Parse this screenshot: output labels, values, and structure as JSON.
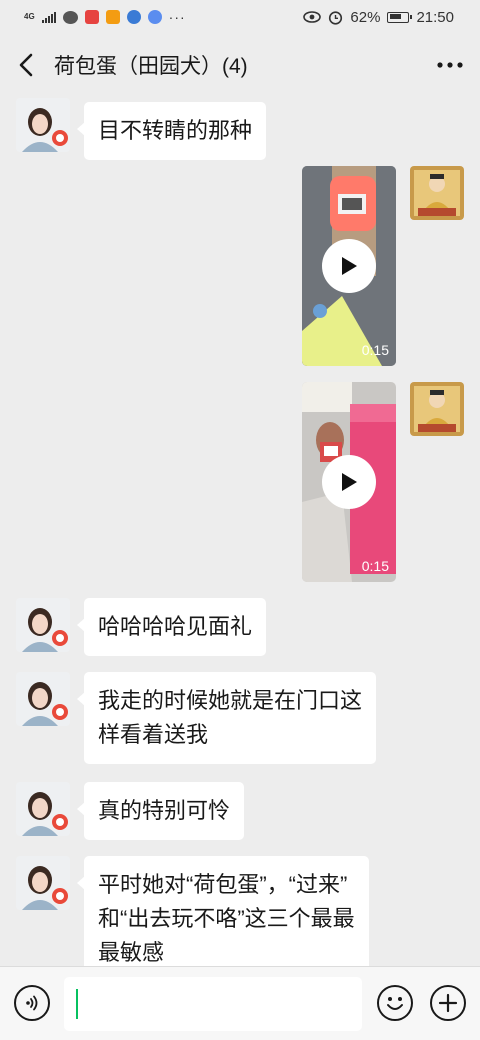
{
  "status_bar": {
    "network": "4G",
    "battery": "62%",
    "time": "21:50",
    "more": "···"
  },
  "header": {
    "title": "荷包蛋（田园犬）(4)"
  },
  "messages": [
    {
      "type": "text",
      "side": "left",
      "text": "目不转睛的那种"
    },
    {
      "type": "video",
      "side": "right",
      "duration": "0:15"
    },
    {
      "type": "video",
      "side": "right",
      "duration": "0:15"
    },
    {
      "type": "text",
      "side": "left",
      "text": "哈哈哈哈见面礼"
    },
    {
      "type": "text",
      "side": "left",
      "lines": [
        "我走的时候她就是在门口这",
        "样看着送我"
      ]
    },
    {
      "type": "text",
      "side": "left",
      "text": "真的特别可怜"
    },
    {
      "type": "text",
      "side": "left",
      "lines": [
        "平时她对“荷包蛋”，“过来”",
        "和“出去玩不咯”这三个最最",
        "最敏感"
      ]
    }
  ],
  "input": {
    "value": "",
    "placeholder": ""
  },
  "icons": {
    "back": "back-arrow-icon",
    "more": "more-dots-icon",
    "voice": "voice-icon",
    "emoji": "emoji-icon",
    "plus": "plus-icon",
    "play": "play-icon"
  },
  "colors": {
    "background": "#ededed",
    "bubble": "#ffffff",
    "accent": "#07c160"
  }
}
